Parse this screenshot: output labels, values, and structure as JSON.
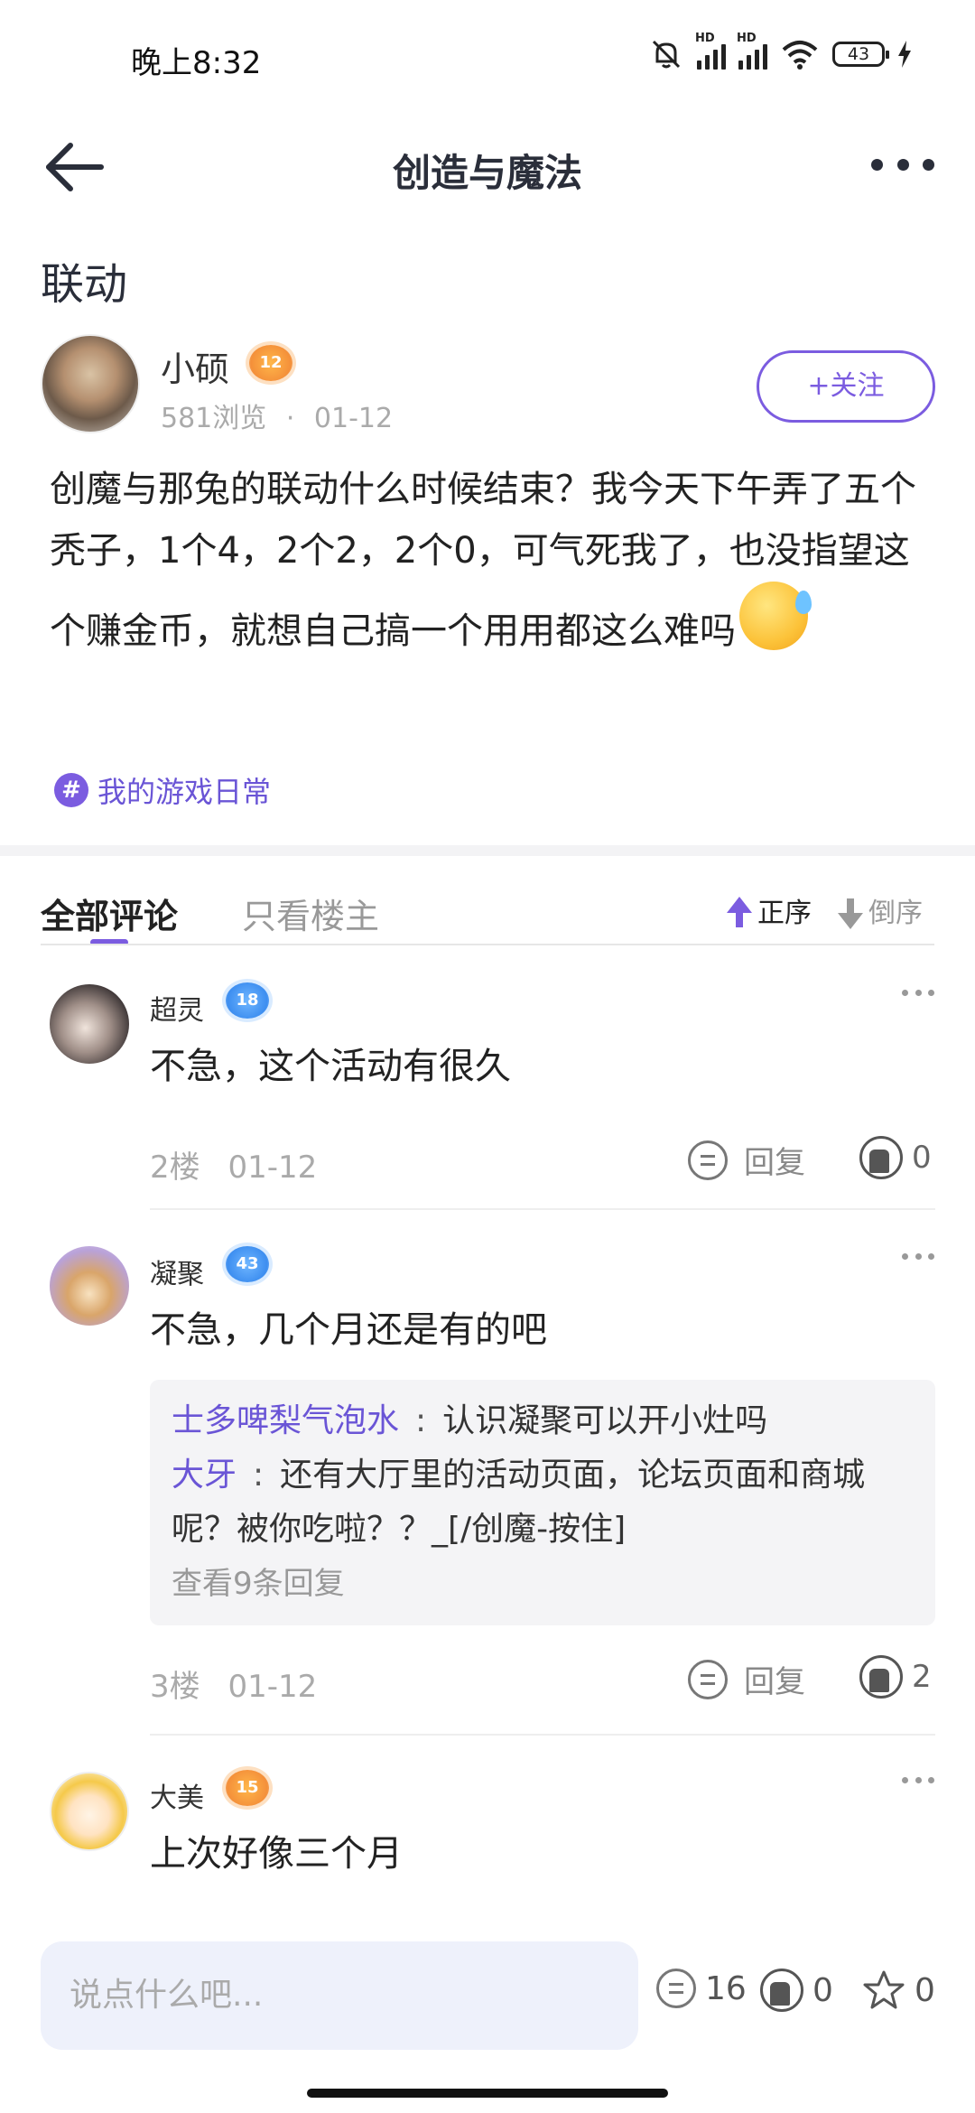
{
  "status_bar": {
    "time": "晚上8:32",
    "battery": "43",
    "hd1": "HD",
    "hd2": "HD"
  },
  "header": {
    "title": "创造与魔法"
  },
  "post": {
    "title": "联动",
    "author": {
      "name": "小硕",
      "level": "12",
      "views": "581浏览",
      "dot": "·",
      "date": "01-12"
    },
    "follow_label": "+关注",
    "body": "创魔与那兔的联动什么时候结束？我今天下午弄了五个秃子，1个4，2个2，2个0，可气死我了，也没指望这个赚金币，就想自己搞一个用用都这么难吗",
    "tag_symbol": "#",
    "tag": "我的游戏日常"
  },
  "tabs": {
    "all": "全部评论",
    "owner_only": "只看楼主",
    "sort_asc": "正序",
    "sort_desc": "倒序"
  },
  "comments": [
    {
      "name": "超灵",
      "level": "18",
      "text": "不急，这个活动有很久",
      "floor": "2楼",
      "date": "01-12",
      "reply_label": "回复",
      "likes": "0"
    },
    {
      "name": "凝聚",
      "level": "43",
      "text": "不急，几个月还是有的吧",
      "floor": "3楼",
      "date": "01-12",
      "reply_label": "回复",
      "likes": "2",
      "replies": [
        {
          "name": "士多啤梨气泡水",
          "colon": ":",
          "text": "认识凝聚可以开小灶吗"
        },
        {
          "name": "大牙",
          "colon": ":",
          "text": "还有大厅里的活动页面，论坛页面和商城呢？被你吃啦？？_[/创魔-按住]"
        }
      ],
      "view_more": "查看9条回复"
    },
    {
      "name": "大美",
      "level": "15",
      "text": "上次好像三个月"
    }
  ],
  "bottom": {
    "placeholder": "说点什么吧...",
    "comments": "16",
    "likes": "0",
    "favorites": "0"
  },
  "colors": {
    "accent": "#7b5ce0",
    "background": "#ffffff"
  }
}
